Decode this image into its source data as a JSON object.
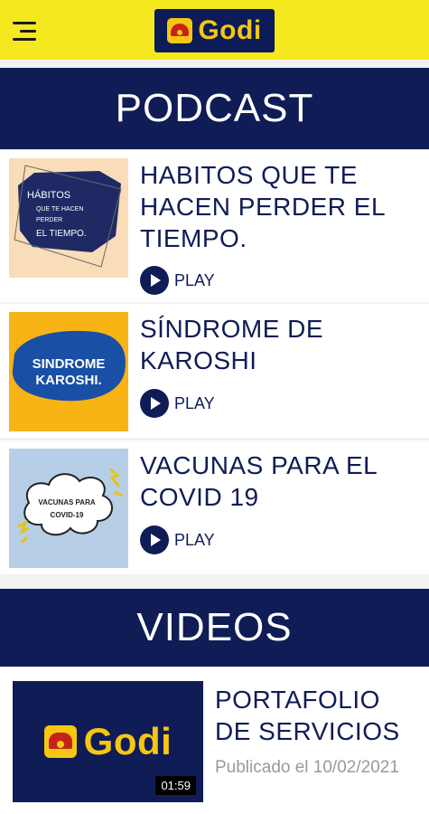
{
  "header": {
    "menu_icon": "hamburger-icon",
    "logo_text": "Godi",
    "colors": {
      "bar": "#f5e81e",
      "brand": "#0f1c56",
      "accent": "#f5c713"
    }
  },
  "podcast": {
    "section_title": "PODCAST",
    "play_label": "PLAY",
    "items": [
      {
        "title": "HABITOS QUE TE HACEN PERDER EL TIEMPO.",
        "thumb_lines": [
          "HÁBITOS",
          "QUE TE HACEN",
          "PERDER",
          "EL TIEMPO."
        ]
      },
      {
        "title": "SÍNDROME DE KAROSHI",
        "thumb_lines": [
          "SINDROME",
          "KAROSHI."
        ]
      },
      {
        "title": "VACUNAS PARA EL COVID 19",
        "thumb_lines": [
          "VACUNAS PARA",
          "COVID-19"
        ]
      }
    ]
  },
  "videos": {
    "section_title": "VIDEOS",
    "items": [
      {
        "title": "PORTAFOLIO DE SERVICIOS",
        "published": "Publicado el 10/02/2021",
        "duration": "01:59",
        "thumb_logo_text": "Godi"
      }
    ]
  }
}
